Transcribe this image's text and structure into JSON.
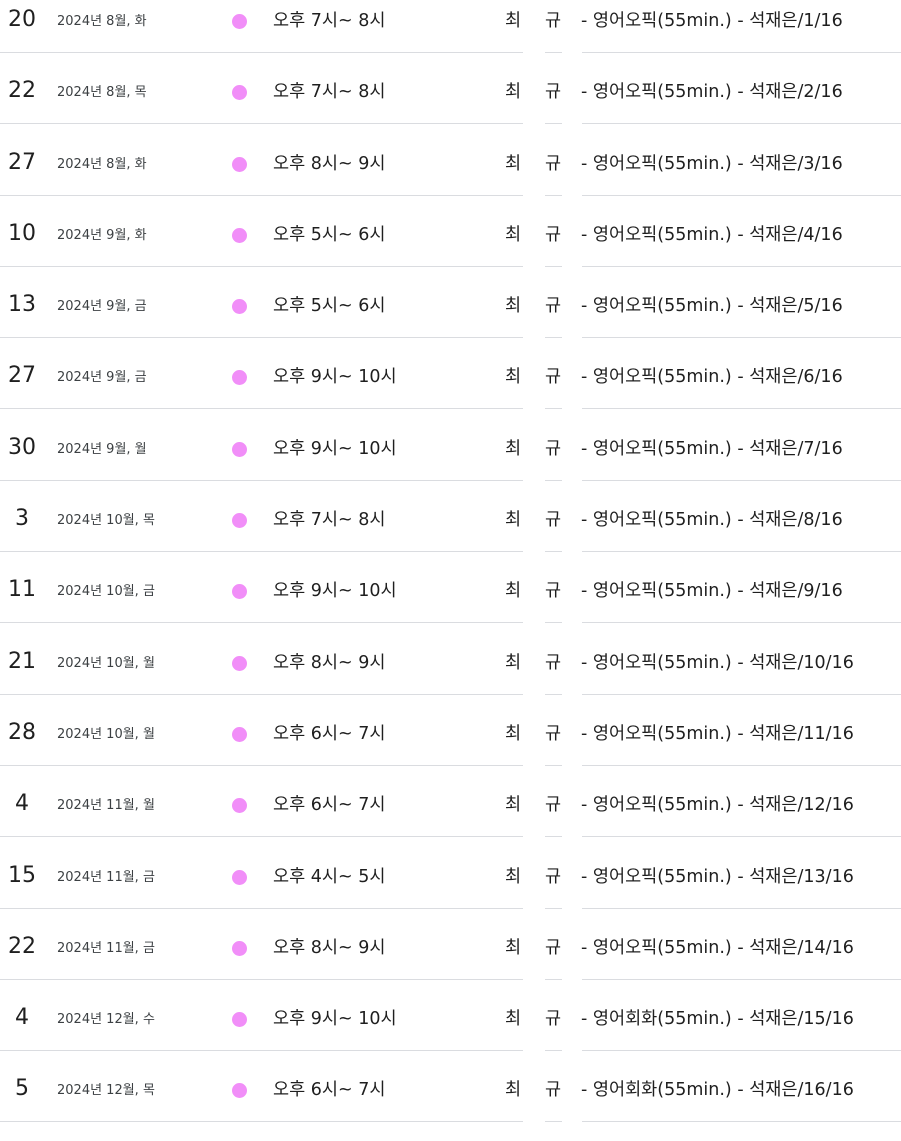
{
  "accent_dot_color": "#f18ef8",
  "events": [
    {
      "day": "20",
      "month_dow": "2024년 8월, 화",
      "time": "오후 7시~ 8시",
      "who_1": "최",
      "who_2": "규",
      "title": "- 영어오픽(55min.) - 석재은/1/16"
    },
    {
      "day": "22",
      "month_dow": "2024년 8월, 목",
      "time": "오후 7시~ 8시",
      "who_1": "최",
      "who_2": "규",
      "title": "- 영어오픽(55min.) - 석재은/2/16"
    },
    {
      "day": "27",
      "month_dow": "2024년 8월, 화",
      "time": "오후 8시~ 9시",
      "who_1": "최",
      "who_2": "규",
      "title": "- 영어오픽(55min.) - 석재은/3/16"
    },
    {
      "day": "10",
      "month_dow": "2024년 9월, 화",
      "time": "오후 5시~ 6시",
      "who_1": "최",
      "who_2": "규",
      "title": "- 영어오픽(55min.) - 석재은/4/16"
    },
    {
      "day": "13",
      "month_dow": "2024년 9월, 금",
      "time": "오후 5시~ 6시",
      "who_1": "최",
      "who_2": "규",
      "title": "- 영어오픽(55min.) - 석재은/5/16"
    },
    {
      "day": "27",
      "month_dow": "2024년 9월, 금",
      "time": "오후 9시~ 10시",
      "who_1": "최",
      "who_2": "규",
      "title": "- 영어오픽(55min.) - 석재은/6/16"
    },
    {
      "day": "30",
      "month_dow": "2024년 9월, 월",
      "time": "오후 9시~ 10시",
      "who_1": "최",
      "who_2": "규",
      "title": "- 영어오픽(55min.) - 석재은/7/16"
    },
    {
      "day": "3",
      "month_dow": "2024년 10월, 목",
      "time": "오후 7시~ 8시",
      "who_1": "최",
      "who_2": "규",
      "title": "- 영어오픽(55min.) - 석재은/8/16"
    },
    {
      "day": "11",
      "month_dow": "2024년 10월, 금",
      "time": "오후 9시~ 10시",
      "who_1": "최",
      "who_2": "규",
      "title": "- 영어오픽(55min.) - 석재은/9/16"
    },
    {
      "day": "21",
      "month_dow": "2024년 10월, 월",
      "time": "오후 8시~ 9시",
      "who_1": "최",
      "who_2": "규",
      "title": "- 영어오픽(55min.) - 석재은/10/16"
    },
    {
      "day": "28",
      "month_dow": "2024년 10월, 월",
      "time": "오후 6시~ 7시",
      "who_1": "최",
      "who_2": "규",
      "title": "- 영어오픽(55min.) - 석재은/11/16"
    },
    {
      "day": "4",
      "month_dow": "2024년 11월, 월",
      "time": "오후 6시~ 7시",
      "who_1": "최",
      "who_2": "규",
      "title": "- 영어오픽(55min.) - 석재은/12/16"
    },
    {
      "day": "15",
      "month_dow": "2024년 11월, 금",
      "time": "오후 4시~ 5시",
      "who_1": "최",
      "who_2": "규",
      "title": "- 영어오픽(55min.) - 석재은/13/16"
    },
    {
      "day": "22",
      "month_dow": "2024년 11월, 금",
      "time": "오후 8시~ 9시",
      "who_1": "최",
      "who_2": "규",
      "title": "- 영어오픽(55min.) - 석재은/14/16"
    },
    {
      "day": "4",
      "month_dow": "2024년 12월, 수",
      "time": "오후 9시~ 10시",
      "who_1": "최",
      "who_2": "규",
      "title": "- 영어회화(55min.) - 석재은/15/16"
    },
    {
      "day": "5",
      "month_dow": "2024년 12월, 목",
      "time": "오후 6시~ 7시",
      "who_1": "최",
      "who_2": "규",
      "title": "- 영어회화(55min.) - 석재은/16/16"
    }
  ]
}
